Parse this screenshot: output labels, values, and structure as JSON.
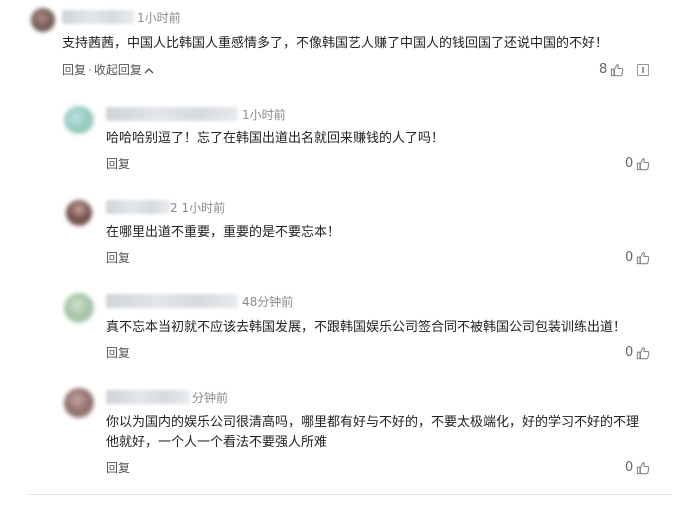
{
  "main_comment": {
    "time": "1小时前",
    "text": "支持茜茜，中国人比韩国人重感情多了，不像韩国艺人赚了中国人的钱回国了还说中国的不好！",
    "reply_label": "回复",
    "separator": "·",
    "collapse_label": "收起回复",
    "collapse_icon": "chevron-up-icon",
    "likes": "8"
  },
  "replies": [
    {
      "time": "1小时前",
      "text": "哈哈哈别逗了！忘了在韩国出道出名就回来赚钱的人了吗！",
      "reply_label": "回复",
      "likes": "0"
    },
    {
      "time": "2 1小时前",
      "text": "在哪里出道不重要，重要的是不要忘本！",
      "reply_label": "回复",
      "likes": "0"
    },
    {
      "time": "48分钟前",
      "text": "真不忘本当初就不应该去韩国发展，不跟韩国娱乐公司签合同不被韩国公司包装训练出道！",
      "reply_label": "回复",
      "likes": "0"
    },
    {
      "time": "分钟前",
      "text_line1": "你以为国内的娱乐公司很清高吗，哪里都有好与不好的，不要太极端化，好的学习不好的不理",
      "text_line2": "他就好，一个人一个看法不要强人所难",
      "reply_label": "回复",
      "likes": "0"
    }
  ],
  "colors": {
    "text": "#222222",
    "meta": "#8a8a8a",
    "link": "#555555"
  }
}
